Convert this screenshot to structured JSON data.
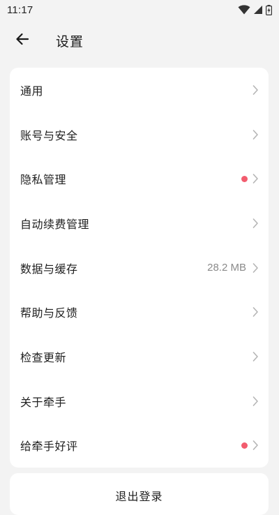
{
  "status_bar": {
    "time": "11:17",
    "icons": [
      "wifi-icon",
      "signal-icon",
      "battery-charging-icon"
    ]
  },
  "header": {
    "back_icon": "arrow-left-icon",
    "title": "设置"
  },
  "settings": {
    "items": [
      {
        "label": "通用"
      },
      {
        "label": "账号与安全"
      },
      {
        "label": "隐私管理",
        "badge": "dot"
      },
      {
        "label": "自动续费管理"
      },
      {
        "label": "数据与缓存",
        "value": "28.2 MB"
      },
      {
        "label": "帮助与反馈"
      },
      {
        "label": "检查更新"
      },
      {
        "label": "关于牵手"
      },
      {
        "label": "给牵手好评",
        "badge": "dot"
      }
    ]
  },
  "logout": {
    "label": "退出登录"
  },
  "colors": {
    "background": "#f3f3f3",
    "card": "#ffffff",
    "badge_dot": "#f25c6e",
    "secondary_text": "#8a8a8a",
    "chevron": "#b5b5b5"
  }
}
